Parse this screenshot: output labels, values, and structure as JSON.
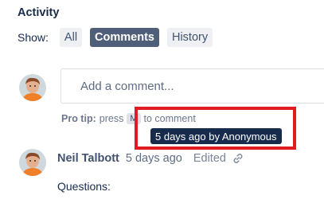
{
  "activity": {
    "heading": "Activity",
    "show_label": "Show:",
    "filters": [
      {
        "label": "All",
        "active": false
      },
      {
        "label": "Comments",
        "active": true
      },
      {
        "label": "History",
        "active": false
      }
    ]
  },
  "composer": {
    "placeholder": "Add a comment...",
    "tip_prefix": "Pro tip:",
    "tip_before_key": "press",
    "tip_key": "M",
    "tip_after_key": "to comment"
  },
  "tooltip": {
    "text": "5 days ago by Anonymous"
  },
  "comment": {
    "author": "Neil Talbott",
    "time": "5 days ago",
    "edited": "Edited",
    "body": "Questions:"
  },
  "colors": {
    "highlight_border": "#e11b22",
    "active_filter": "#505f79",
    "tooltip_bg": "#172b4d"
  },
  "icons": {
    "permalink": "link-icon",
    "avatar": "user-avatar"
  }
}
